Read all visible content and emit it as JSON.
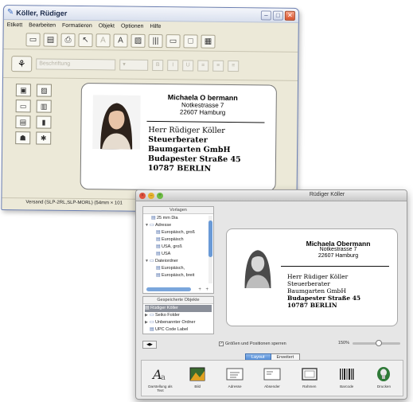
{
  "back_window": {
    "title": "Köller, Rüdiger",
    "menu": [
      "Etikett",
      "Bearbeiten",
      "Formatieren",
      "Objekt",
      "Optionen",
      "Hilfe"
    ],
    "font_placeholder": "Beschriftung",
    "status_text": "Versand (SLP-2RL,SLP-MORL) (54mm × 101"
  },
  "front_window": {
    "title": "Rüdiger Köller",
    "templates_panel": {
      "header": "Vorlagen",
      "items": [
        {
          "label": "25 mm Dia",
          "level": 1,
          "icon": "label"
        },
        {
          "label": "Adresse",
          "level": 0,
          "icon": "folder",
          "expanded": true
        },
        {
          "label": "Europäisch, groß",
          "level": 2,
          "icon": "label"
        },
        {
          "label": "Europäisch",
          "level": 2,
          "icon": "label"
        },
        {
          "label": "USA, groß",
          "level": 2,
          "icon": "label"
        },
        {
          "label": "USA",
          "level": 2,
          "icon": "label"
        },
        {
          "label": "Dateiordner",
          "level": 0,
          "icon": "folder",
          "expanded": true
        },
        {
          "label": "Europäisch,",
          "level": 2,
          "icon": "label"
        },
        {
          "label": "Europäisch, breit",
          "level": 2,
          "icon": "label"
        }
      ]
    },
    "saved_panel": {
      "header": "Gespeicherte Objekte",
      "items": [
        {
          "label": "Rüdiger Köller",
          "selected": true,
          "icon": "label"
        },
        {
          "label": "Seiko Folder",
          "selected": false,
          "icon": "folder"
        },
        {
          "label": "Unbenannter Ordner",
          "selected": false,
          "icon": "folder"
        },
        {
          "label": "UPC Code Label",
          "selected": false,
          "icon": "label"
        }
      ]
    },
    "checkbox_label": "Größen und Positionen sperren",
    "zoom_label": "150%",
    "zoom_fraction": 0.55,
    "tabs": {
      "layout": "Layout",
      "advanced": "Erweitert"
    },
    "bottom_items": [
      {
        "label": "Darstellung als Text",
        "icon": "text-style-icon"
      },
      {
        "label": "Bild",
        "icon": "image-icon"
      },
      {
        "label": "Adresse",
        "icon": "address-icon"
      },
      {
        "label": "Absender",
        "icon": "sender-icon"
      },
      {
        "label": "Rahmen",
        "icon": "frame-icon"
      },
      {
        "label": "Barcode",
        "icon": "barcode-icon"
      },
      {
        "label": "Drucken",
        "icon": "print-icon"
      }
    ]
  },
  "label": {
    "sender_name": "Michaela Obermann",
    "sender_street": "Notkestrasse 7",
    "sender_city": "22607 Hamburg",
    "back_sender_name": "Michaela O bermann",
    "recipient": [
      "Herr Rüdiger Köller",
      "Steuerberater",
      "Baumgarten GmbH",
      "Budapester Straße 45",
      "10787 BERLIN"
    ]
  }
}
